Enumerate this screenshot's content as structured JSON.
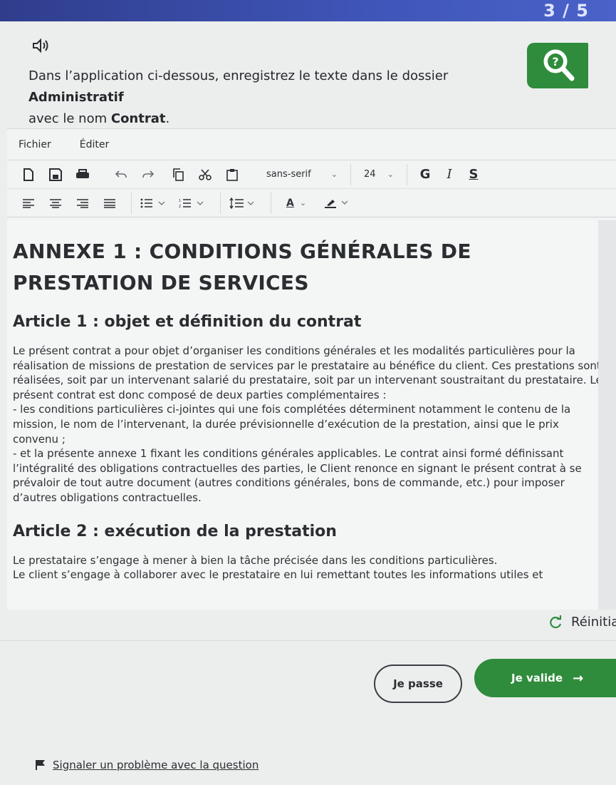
{
  "progress": "3 / 5",
  "instructions": {
    "line1_pre": "Dans l’application ci-dessous, enregistrez le texte dans le dossier ",
    "folder": "Administratif",
    "line2_pre": "avec le nom ",
    "filename": "Contrat",
    "line2_post": "."
  },
  "menu": {
    "file": "Fichier",
    "edit": "Éditer"
  },
  "toolbar": {
    "font_family": "sans-serif",
    "font_size": "24",
    "bold": "G",
    "italic": "I",
    "underline": "S",
    "text_color_label": "A"
  },
  "document": {
    "title": "ANNEXE 1 : CONDITIONS GÉNÉRALES DE PRESTATION DE SERVICES",
    "article1_heading": "Article 1 : objet et définition du contrat",
    "article1_p1": "Le présent contrat a pour objet d’organiser les conditions générales et les modalités particulières pour la réalisation de missions de prestation de services par le prestataire au bénéfice du client. Ces prestations sont réalisées, soit par un intervenant salarié du prestataire, soit par un intervenant soustraitant du prestataire. Le présent contrat est donc composé de deux parties complémentaires :",
    "article1_p2": "- les conditions particulières ci-jointes qui une fois complétées déterminent notamment le contenu de la mission, le nom de l’intervenant, la durée prévisionnelle d’exécution de la prestation, ainsi que le prix convenu ;",
    "article1_p3": "- et la présente annexe 1 fixant les conditions générales applicables. Le contrat ainsi formé définissant l’intégralité des obligations contractuelles des parties, le Client renonce en signant le présent contrat à se prévaloir de tout autre document (autres conditions générales, bons de commande, etc.) pour imposer d’autres obligations contractuelles.",
    "article2_heading": "Article 2 : exécution de la prestation",
    "article2_p1": "Le prestataire s’engage à mener à bien la tâche précisée dans les conditions particulières.",
    "article2_p2": "Le client s’engage à collaborer avec le prestataire en lui remettant toutes les informations utiles et"
  },
  "actions": {
    "reset": "Réinitialise",
    "skip": "Je passe",
    "validate": "Je valide",
    "report": "Signaler un problème avec la question"
  },
  "colors": {
    "accent_green": "#2f8c3c",
    "header_blue": "#3f55b8"
  }
}
